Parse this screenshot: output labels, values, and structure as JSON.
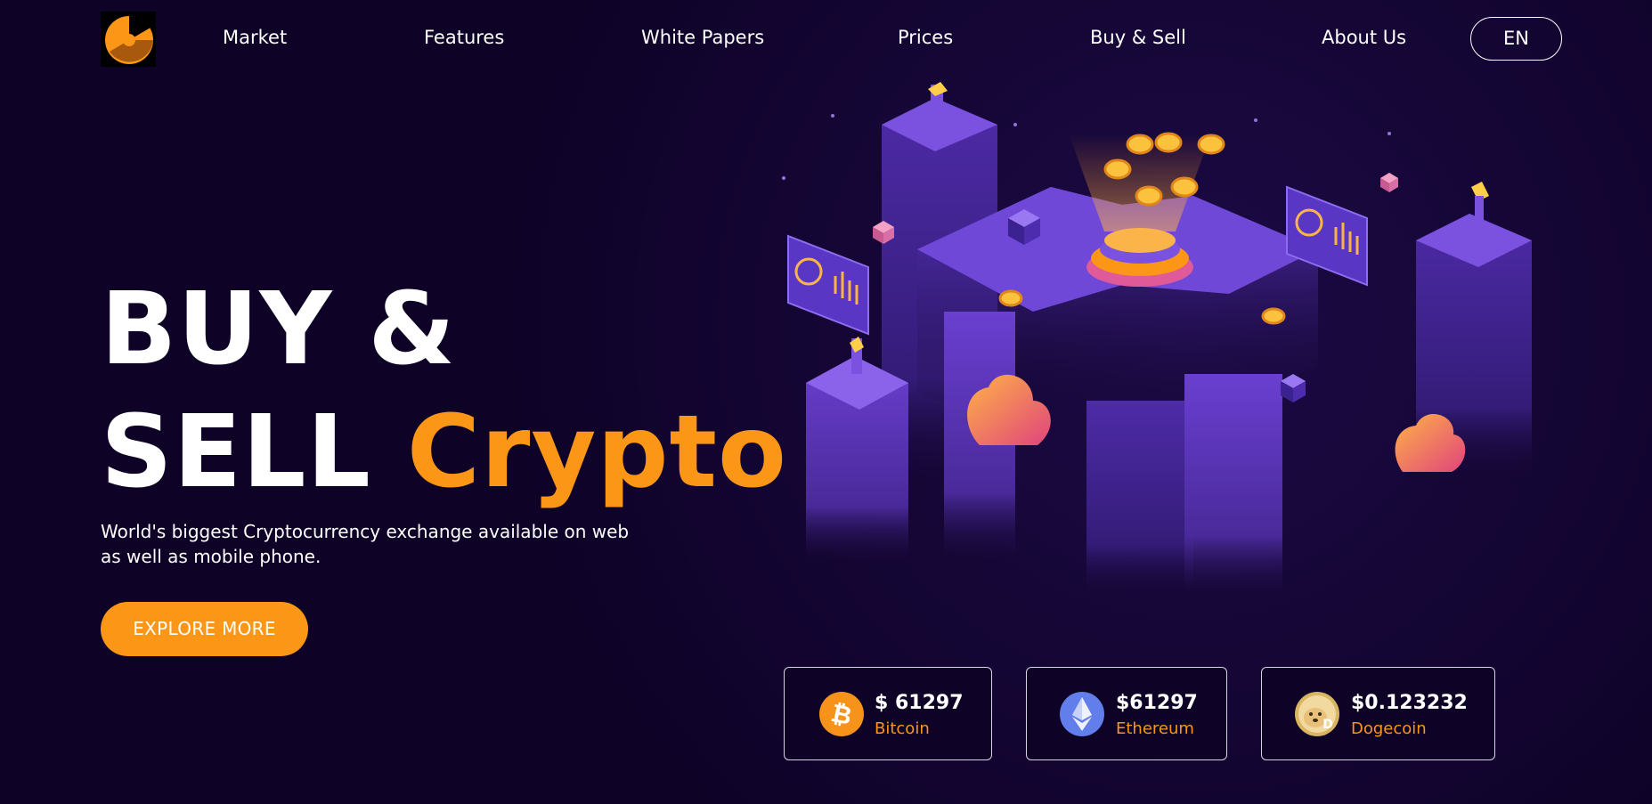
{
  "nav": {
    "items": [
      {
        "label": "Market"
      },
      {
        "label": "Features"
      },
      {
        "label": "White Papers"
      },
      {
        "label": "Prices"
      },
      {
        "label": "Buy & Sell"
      },
      {
        "label": "About Us"
      }
    ],
    "language": "EN"
  },
  "hero": {
    "line1": "BUY &",
    "line2_plain": "SELL",
    "line2_accent": "Crypto",
    "subtitle": "World's biggest Cryptocurrency exchange available on web as well as mobile phone.",
    "cta_label": "EXPLORE MORE"
  },
  "prices": [
    {
      "price": "$ 61297",
      "name": "Bitcoin",
      "icon": "bitcoin-icon"
    },
    {
      "price": "$61297",
      "name": "Ethereum",
      "icon": "ethereum-icon"
    },
    {
      "price": "$0.123232",
      "name": "Dogecoin",
      "icon": "dogecoin-icon"
    }
  ],
  "colors": {
    "background": "#0e0226",
    "accent": "#fb9617",
    "illustration_purple": "#6b3fd6",
    "bitcoin": "#f7931a",
    "ethereum": "#627eea"
  }
}
